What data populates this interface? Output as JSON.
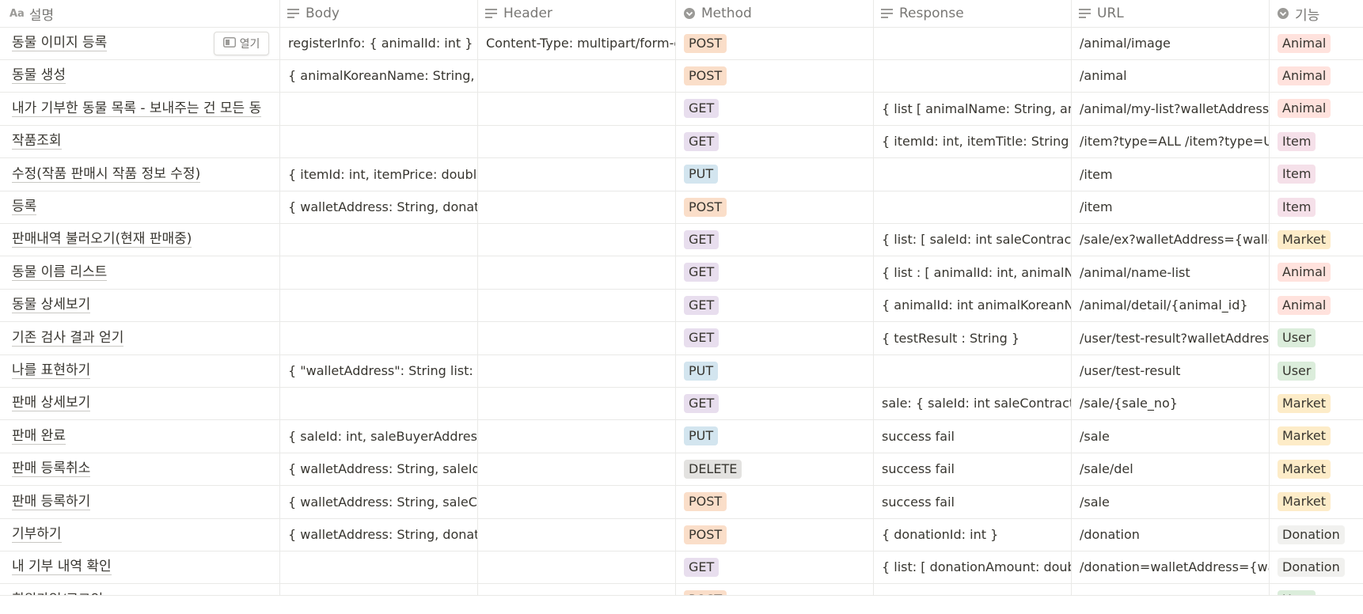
{
  "columns": {
    "title": "설명",
    "body": "Body",
    "header": "Header",
    "method": "Method",
    "response": "Response",
    "url": "URL",
    "feature": "기능"
  },
  "open_button_label": "열기",
  "method_colors": {
    "POST": "#fadec9",
    "GET": "#e8deee",
    "PUT": "#d3e5ef",
    "DELETE": "#e3e2e0"
  },
  "feature_colors": {
    "Animal": "#ffe2dd",
    "Item": "#f5e0e9",
    "Market": "#fdecc8",
    "User": "#dbeddb",
    "Donation": "#f1f1ef"
  },
  "rows": [
    {
      "title": "동물 이미지 등록",
      "body": "registerInfo: { animalId: int } (ap",
      "header": "Content-Type: multipart/form-d",
      "method": "POST",
      "response": "",
      "url": "/animal/image",
      "feature": "Animal"
    },
    {
      "title": "동물 생성",
      "body": "{ animalKoreanName: String, an",
      "header": "",
      "method": "POST",
      "response": "",
      "url": "/animal",
      "feature": "Animal"
    },
    {
      "title": "내가 기부한 동물 목록 - 보내주는 건 모든 동",
      "body": "",
      "header": "",
      "method": "GET",
      "response": "{ list [ animalName: String, anim",
      "url": "/animal/my-list?walletAddress=",
      "feature": "Animal"
    },
    {
      "title": "작품조회",
      "body": "",
      "header": "",
      "method": "GET",
      "response": "{ itemId: int, itemTitle: String ite",
      "url": "/item?type=ALL /item?type=Us",
      "feature": "Item"
    },
    {
      "title": "수정(작품 판매시 작품 정보 수정)",
      "body": "{ itemId: int, itemPrice: double,",
      "header": "",
      "method": "PUT",
      "response": "",
      "url": "/item",
      "feature": "Item"
    },
    {
      "title": "등록",
      "body": "{ walletAddress: String, donatio",
      "header": "",
      "method": "POST",
      "response": "",
      "url": "/item",
      "feature": "Item"
    },
    {
      "title": "판매내역 불러오기(현재 판매중)",
      "body": "",
      "header": "",
      "method": "GET",
      "response": "{ list: [ saleId: int saleContractAd",
      "url": "/sale/ex?walletAddress={wallet",
      "feature": "Market"
    },
    {
      "title": "동물 이름 리스트",
      "body": "",
      "header": "",
      "method": "GET",
      "response": "{ list : [ animalId: int, animalNam",
      "url": "/animal/name-list",
      "feature": "Animal"
    },
    {
      "title": "동물 상세보기",
      "body": "",
      "header": "",
      "method": "GET",
      "response": "{ animalId: int animalKoreanNa",
      "url": "/animal/detail/{animal_id}",
      "feature": "Animal"
    },
    {
      "title": "기존 검사 결과 얻기",
      "body": "",
      "header": "",
      "method": "GET",
      "response": "{ testResult : String }",
      "url": "/user/test-result?walletAddress",
      "feature": "User"
    },
    {
      "title": "나를 표현하기",
      "body": "{ \"walletAddress\": String list: Str",
      "header": "",
      "method": "PUT",
      "response": "",
      "url": "/user/test-result",
      "feature": "User"
    },
    {
      "title": "판매 상세보기",
      "body": "",
      "header": "",
      "method": "GET",
      "response": "sale: { saleId: int saleContractAd",
      "url": "/sale/{sale_no}",
      "feature": "Market"
    },
    {
      "title": "판매 완료",
      "body": "{ saleId: int, saleBuyerAddress: S",
      "header": "",
      "method": "PUT",
      "response": "success fail",
      "url": "/sale",
      "feature": "Market"
    },
    {
      "title": "판매 등록취소",
      "body": "{ walletAddress: String, saleId: i",
      "header": "",
      "method": "DELETE",
      "response": "success fail",
      "url": "/sale/del",
      "feature": "Market"
    },
    {
      "title": "판매 등록하기",
      "body": "{ walletAddress: String, saleCon",
      "header": "",
      "method": "POST",
      "response": "success fail",
      "url": "/sale",
      "feature": "Market"
    },
    {
      "title": "기부하기",
      "body": "{ walletAddress: String, donatio",
      "header": "",
      "method": "POST",
      "response": "{ donationId: int }",
      "url": "/donation",
      "feature": "Donation"
    },
    {
      "title": "내 기부 내역 확인",
      "body": "",
      "header": "",
      "method": "GET",
      "response": "{ list: [ donationAmount: doubl",
      "url": "/donation=walletAddress={wal",
      "feature": "Donation"
    },
    {
      "title": "회원가입/로그인",
      "body": "{ \"walletAddress\": String }",
      "header": "",
      "method": "POST",
      "response": "{ userId: int, userNickname",
      "url": "/user/login",
      "feature": "User"
    }
  ]
}
